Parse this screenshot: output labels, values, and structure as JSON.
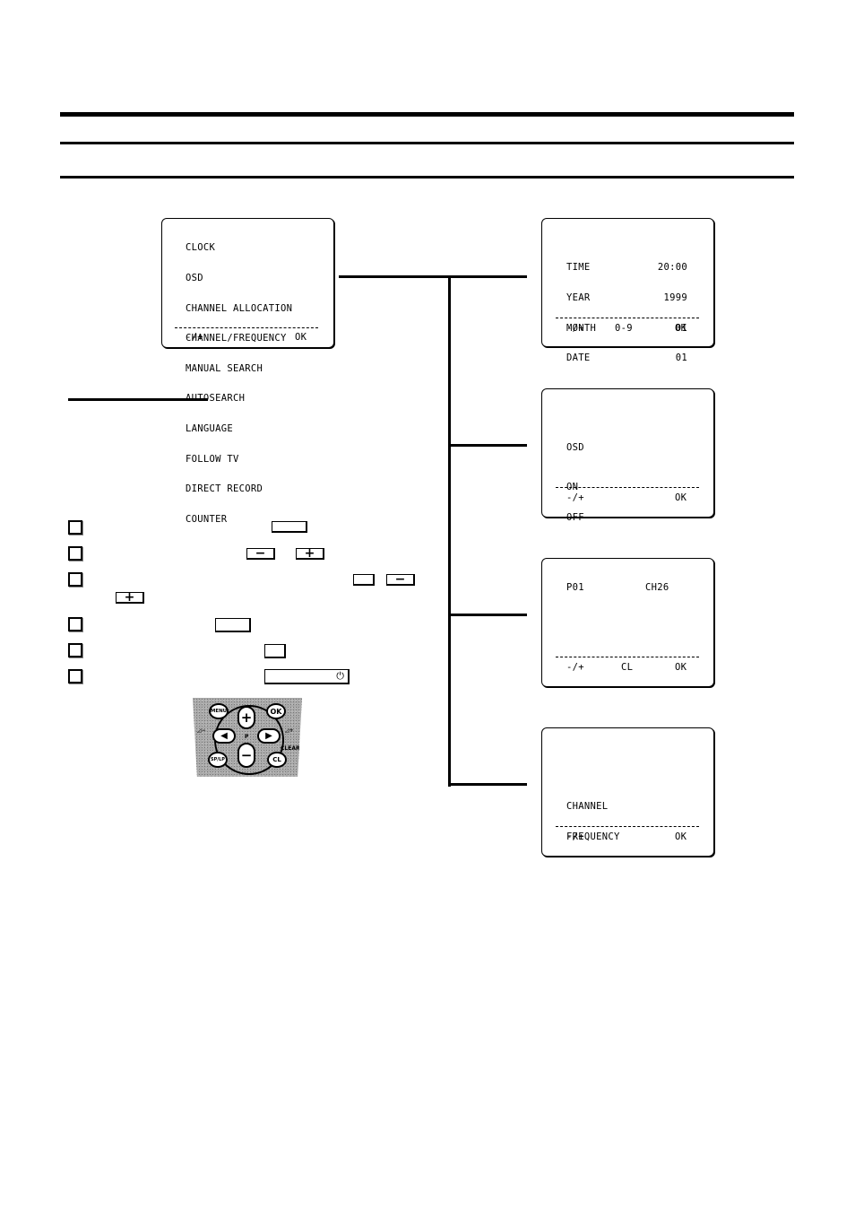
{
  "main_menu": {
    "items": [
      "CLOCK",
      "OSD",
      "CHANNEL ALLOCATION",
      "CHANNEL/FREQUENCY",
      "MANUAL SEARCH",
      "AUTOSEARCH",
      "LANGUAGE",
      "FOLLOW TV",
      "DIRECT RECORD",
      "COUNTER"
    ],
    "footer_left": "-/+",
    "footer_right": "OK"
  },
  "clock_screen": {
    "rows": [
      {
        "label": "TIME",
        "value": "20:00"
      },
      {
        "label": "YEAR",
        "value": "1999"
      },
      {
        "label": "MONTH",
        "value": "01"
      },
      {
        "label": "DATE",
        "value": "01"
      }
    ],
    "footer_left": "-/+",
    "footer_mid": "0-9",
    "footer_right": "OK"
  },
  "osd_screen": {
    "title": "OSD",
    "options": [
      "ON",
      "OFF"
    ],
    "footer_left": "-/+",
    "footer_right": "OK"
  },
  "channel_screen": {
    "program": "P01",
    "channel": "CH26",
    "footer_left": "-/+",
    "footer_mid": "CL",
    "footer_right": "OK"
  },
  "freq_screen": {
    "options": [
      "CHANNEL",
      "FREQUENCY"
    ],
    "footer_left": "-/+",
    "footer_right": "OK"
  },
  "steps": {
    "minus_glyph": "−",
    "plus_glyph": "+",
    "power_glyph": "⏻"
  },
  "remote": {
    "menu": "MENU",
    "ok": "OK",
    "plus": "+",
    "minus": "−",
    "left": "◀",
    "right": "▶",
    "sp_lp": "SP/LP",
    "cl": "CL",
    "clear": "CLEAR",
    "p": "P",
    "vol_minus": "◿−",
    "vol_plus": "◿+"
  }
}
